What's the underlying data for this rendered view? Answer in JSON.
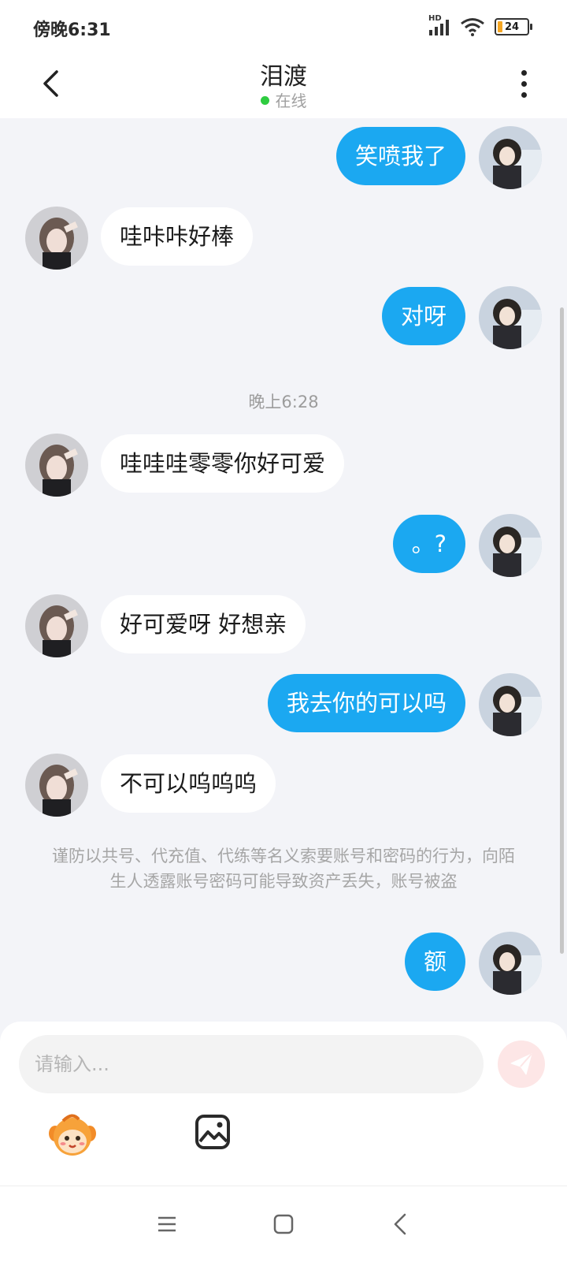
{
  "status_bar": {
    "time": "傍晚6:31",
    "network_label": "HD",
    "battery": "24",
    "icons": [
      "signal-icon",
      "wifi-icon",
      "battery-icon"
    ]
  },
  "header": {
    "title": "泪渡",
    "status": "在线",
    "status_color": "#2ecc40",
    "back_icon": "chevron-left-icon",
    "more_icon": "more-vertical-icon"
  },
  "messages": [
    {
      "side": "right",
      "text": "笑喷我了"
    },
    {
      "side": "left",
      "text": "哇咔咔好棒"
    },
    {
      "side": "right",
      "text": "对呀"
    },
    {
      "timestamp": "晚上6:28"
    },
    {
      "side": "left",
      "text": "哇哇哇零零你好可爱"
    },
    {
      "side": "right",
      "text": "。?"
    },
    {
      "side": "left",
      "text": "好可爱呀 好想亲"
    },
    {
      "side": "right",
      "text": "我去你的可以吗"
    },
    {
      "side": "left",
      "text": "不可以呜呜呜"
    },
    {
      "notice": "谨防以共号、代充值、代练等名义索要账号和密码的行为，向陌生人透露账号密码可能导致资产丢失，账号被盗"
    },
    {
      "side": "right",
      "text": "额"
    }
  ],
  "composer": {
    "placeholder": "请输入...",
    "send_icon": "send-icon",
    "emoji_icon": "emoji-icon",
    "image_icon": "image-icon"
  },
  "colors": {
    "outgoing_bubble": "#1ba8f1",
    "incoming_bubble": "#ffffff",
    "background": "#f3f4f8"
  },
  "navbar": {
    "icons": [
      "menu-icon",
      "home-icon",
      "back-icon"
    ]
  }
}
